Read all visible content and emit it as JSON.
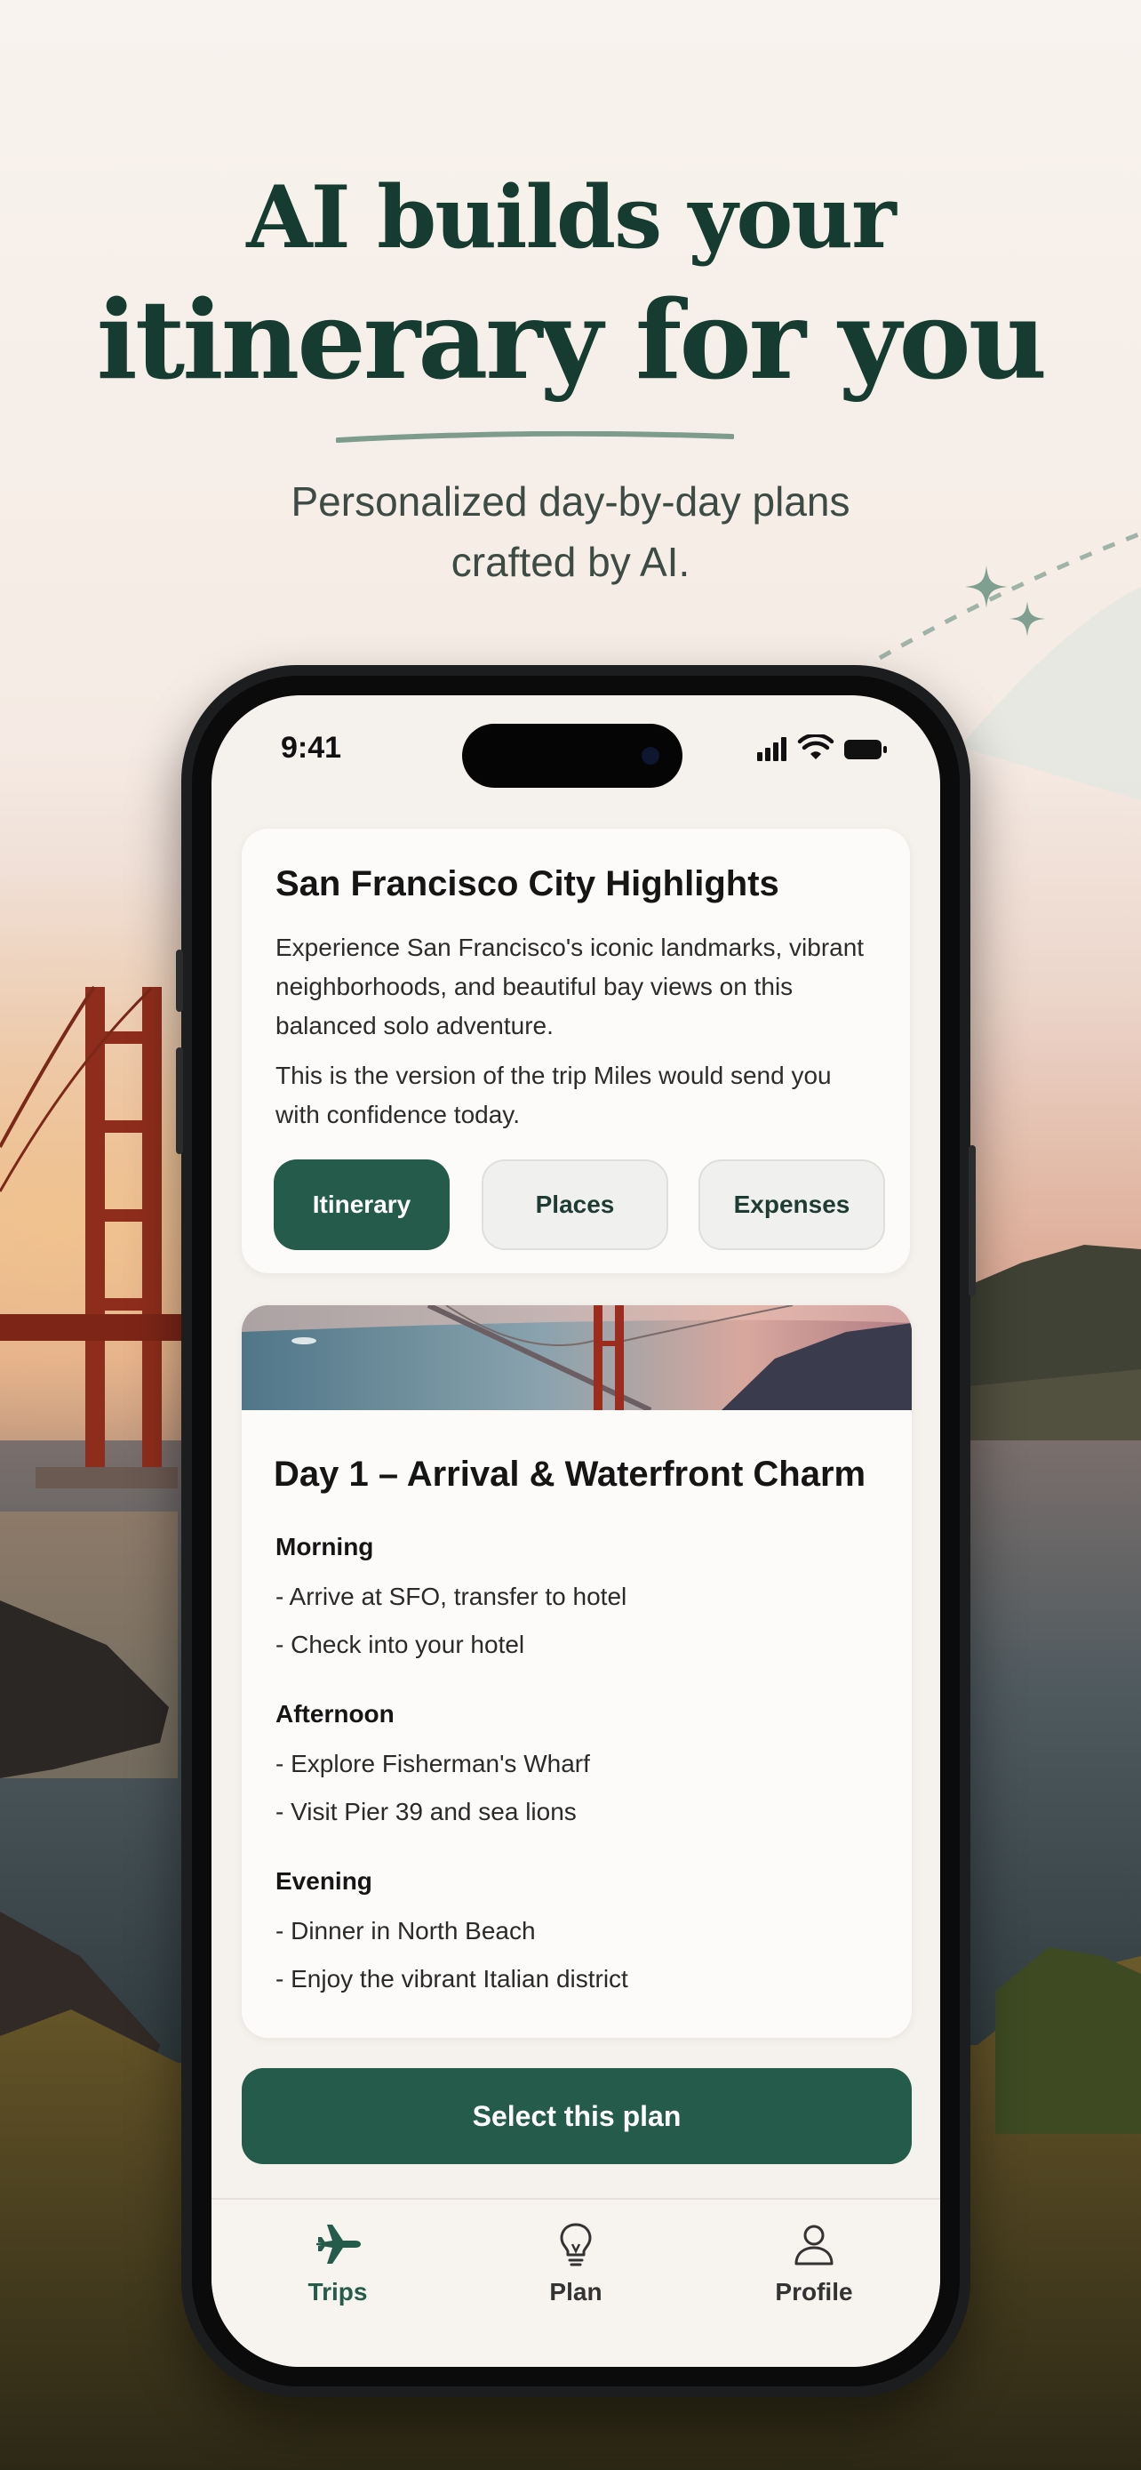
{
  "headline": {
    "line1": "AI builds your",
    "line2": "itinerary for you",
    "subtitle_line1": "Personalized day-by-day plans",
    "subtitle_line2": "crafted by AI."
  },
  "status_bar": {
    "time": "9:41"
  },
  "trip": {
    "title": "San Francisco City Highlights",
    "description": "Experience San Francisco's iconic landmarks, vibrant neighborhoods, and beautiful bay views on this balanced solo adventure.",
    "note": "This is the version of the trip Miles would send you with confidence today.",
    "tabs": [
      "Itinerary",
      "Places",
      "Expenses"
    ],
    "active_tab": "Itinerary"
  },
  "day": {
    "title": "Day 1 – Arrival & Waterfront Charm",
    "sections": [
      {
        "label": "Morning",
        "items": [
          "- Arrive at SFO, transfer to hotel",
          "- Check into your hotel"
        ]
      },
      {
        "label": "Afternoon",
        "items": [
          "- Explore Fisherman's Wharf",
          "- Visit Pier 39 and sea lions"
        ]
      },
      {
        "label": "Evening",
        "items": [
          "- Dinner in North Beach",
          "- Enjoy the vibrant Italian district"
        ]
      }
    ]
  },
  "cta": {
    "label": "Select this plan"
  },
  "tab_bar": {
    "items": [
      {
        "label": "Trips",
        "icon": "airplane-icon",
        "active": true
      },
      {
        "label": "Plan",
        "icon": "lightbulb-icon",
        "active": false
      },
      {
        "label": "Profile",
        "icon": "person-icon",
        "active": false
      }
    ]
  },
  "colors": {
    "accent": "#255b4a",
    "headline": "#163c31",
    "background": "#f6efe9"
  }
}
